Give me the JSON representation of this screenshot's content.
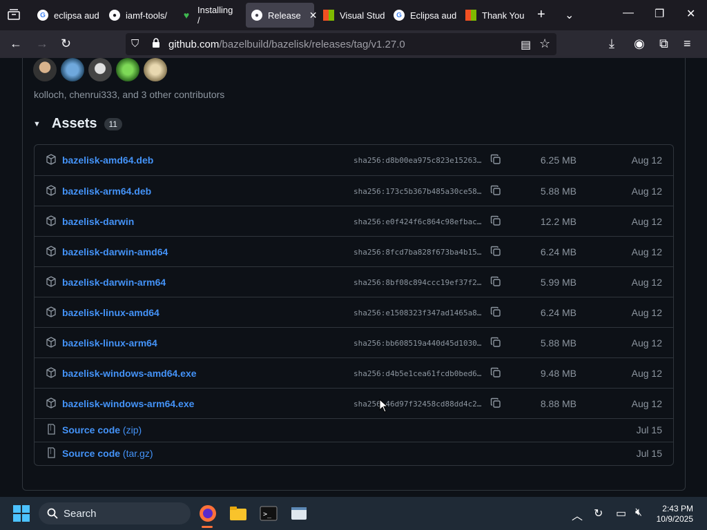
{
  "tabs": [
    {
      "label": "eclipsa aud",
      "icon": "google-icon"
    },
    {
      "label": "iamf-tools/",
      "icon": "github-icon"
    },
    {
      "label": "Installing /",
      "icon": "heart-icon"
    },
    {
      "label": "Release",
      "icon": "github-icon",
      "active": true
    },
    {
      "label": "Visual Stud",
      "icon": "microsoft-icon"
    },
    {
      "label": "Eclipsa aud",
      "icon": "google-icon"
    },
    {
      "label": "Thank You",
      "icon": "microsoft-icon"
    }
  ],
  "url": {
    "host": "github.com",
    "path": "/bazelbuild/bazelisk/releases/tag/v1.27.0"
  },
  "contributors_text": "kolloch, chenrui333, and 3 other contributors",
  "assets": {
    "title": "Assets",
    "count": "11",
    "files": [
      {
        "name": "bazelisk-amd64.deb",
        "sha": "sha256:d8b00ea975c823e15263…",
        "size": "6.25 MB",
        "date": "Aug 12"
      },
      {
        "name": "bazelisk-arm64.deb",
        "sha": "sha256:173c5b367b485a30ce58…",
        "size": "5.88 MB",
        "date": "Aug 12"
      },
      {
        "name": "bazelisk-darwin",
        "sha": "sha256:e0f424f6c864c98efbac…",
        "size": "12.2 MB",
        "date": "Aug 12"
      },
      {
        "name": "bazelisk-darwin-amd64",
        "sha": "sha256:8fcd7ba828f673ba4b15…",
        "size": "6.24 MB",
        "date": "Aug 12"
      },
      {
        "name": "bazelisk-darwin-arm64",
        "sha": "sha256:8bf08c894ccc19ef37f2…",
        "size": "5.99 MB",
        "date": "Aug 12"
      },
      {
        "name": "bazelisk-linux-amd64",
        "sha": "sha256:e1508323f347ad1465a8…",
        "size": "6.24 MB",
        "date": "Aug 12"
      },
      {
        "name": "bazelisk-linux-arm64",
        "sha": "sha256:bb608519a440d45d1030…",
        "size": "5.88 MB",
        "date": "Aug 12"
      },
      {
        "name": "bazelisk-windows-amd64.exe",
        "sha": "sha256:d4b5e1cea61fcdb0bed6…",
        "size": "9.48 MB",
        "date": "Aug 12"
      },
      {
        "name": "bazelisk-windows-arm64.exe",
        "sha": "sha256:46d97f32458cd88dd4c2…",
        "size": "8.88 MB",
        "date": "Aug 12"
      }
    ],
    "sources": [
      {
        "name": "Source code",
        "ext": "(zip)",
        "date": "Jul 15"
      },
      {
        "name": "Source code",
        "ext": "(tar.gz)",
        "date": "Jul 15"
      }
    ]
  },
  "taskbar": {
    "search_label": "Search",
    "time": "2:43 PM",
    "date": "10/9/2025"
  },
  "colors": {
    "link": "#4493f8",
    "bg": "#0d1117",
    "border": "#30363d",
    "muted": "#8d96a0"
  }
}
